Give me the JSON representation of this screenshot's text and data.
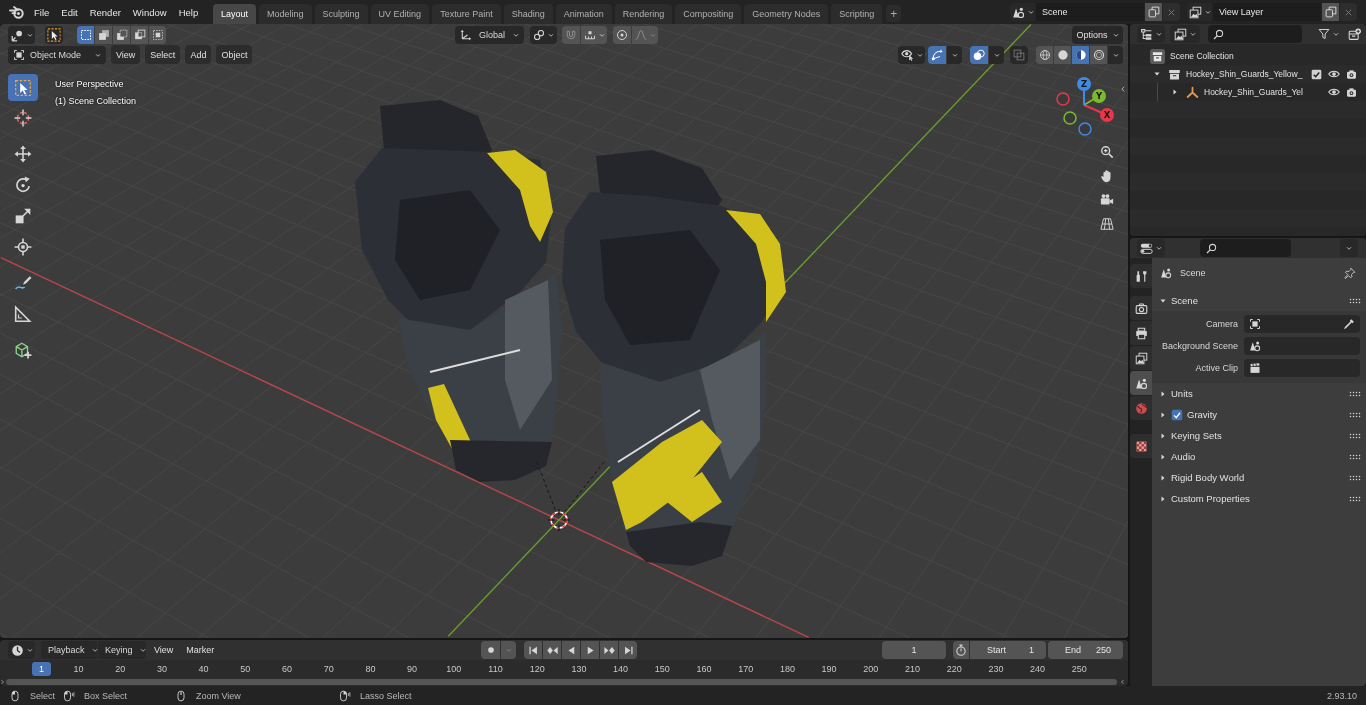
{
  "topbar": {
    "menus": [
      "File",
      "Edit",
      "Render",
      "Window",
      "Help"
    ],
    "workspaces": [
      {
        "label": "Layout",
        "selected": true
      },
      {
        "label": "Modeling",
        "selected": false
      },
      {
        "label": "Sculpting",
        "selected": false
      },
      {
        "label": "UV Editing",
        "selected": false
      },
      {
        "label": "Texture Paint",
        "selected": false
      },
      {
        "label": "Shading",
        "selected": false
      },
      {
        "label": "Animation",
        "selected": false
      },
      {
        "label": "Rendering",
        "selected": false
      },
      {
        "label": "Compositing",
        "selected": false
      },
      {
        "label": "Geometry Nodes",
        "selected": false
      },
      {
        "label": "Scripting",
        "selected": false
      }
    ],
    "add_workspace": "+",
    "scene": "Scene",
    "view_layer": "View Layer"
  },
  "viewport": {
    "tool_header": {
      "select_modes": [
        {
          "kind": "set",
          "selected": true
        },
        {
          "kind": "extend",
          "selected": false
        },
        {
          "kind": "subtract",
          "selected": false
        },
        {
          "kind": "difference",
          "selected": false
        },
        {
          "kind": "intersect",
          "selected": false
        }
      ],
      "orientation": "Global",
      "options": "Options"
    },
    "header": {
      "mode": "Object Mode",
      "menus": [
        "View",
        "Select",
        "Add",
        "Object"
      ],
      "toggles": [
        {
          "kind": "selectability",
          "on": false
        },
        {
          "kind": "gizmo",
          "on": true
        },
        {
          "kind": "overlay",
          "on": true
        },
        {
          "kind": "xray",
          "on": false
        }
      ],
      "shading": [
        {
          "kind": "wireframe",
          "selected": false
        },
        {
          "kind": "solid",
          "selected": false
        },
        {
          "kind": "material",
          "selected": true
        },
        {
          "kind": "rendered",
          "selected": false
        }
      ]
    },
    "view_name": "User Perspective",
    "collection_label": "(1) Scene Collection",
    "tool_groups": [
      [
        {
          "kind": "select_box",
          "selected": true
        }
      ],
      [
        {
          "kind": "cursor",
          "selected": false
        }
      ],
      [
        {
          "kind": "move",
          "selected": false
        },
        {
          "kind": "rotate",
          "selected": false
        },
        {
          "kind": "scale",
          "selected": false
        },
        {
          "kind": "transform",
          "selected": false
        }
      ],
      [
        {
          "kind": "annotate",
          "selected": false
        },
        {
          "kind": "measure",
          "selected": false
        }
      ],
      [
        {
          "kind": "add_cube",
          "selected": false
        }
      ]
    ],
    "nav_axes": [
      {
        "label": "X",
        "color": "#e8374b"
      },
      {
        "label": "Y",
        "color": "#7bb92e"
      },
      {
        "label": "Z",
        "color": "#3f8ae5"
      }
    ]
  },
  "outliner": {
    "tree": [
      {
        "label": "Scene Collection",
        "kind": "scene_collection",
        "children": [
          {
            "label": "Hockey_Shin_Guards_Yellow_",
            "kind": "collection",
            "expanded": true,
            "checked": true,
            "visible": true,
            "renderable": true,
            "children": [
              {
                "label": "Hockey_Shin_Guards_Yel",
                "kind": "empty",
                "expanded": false,
                "visible": true,
                "renderable": true
              }
            ]
          }
        ]
      }
    ]
  },
  "properties": {
    "tab_groups": [
      [
        {
          "kind": "tool",
          "selected": false
        }
      ],
      [
        {
          "kind": "render",
          "selected": false
        },
        {
          "kind": "output",
          "selected": false
        },
        {
          "kind": "view_layer",
          "selected": false
        },
        {
          "kind": "scene",
          "selected": true
        },
        {
          "kind": "world",
          "selected": false
        }
      ],
      [
        {
          "kind": "texture",
          "selected": false
        }
      ]
    ],
    "context": "Scene",
    "panels": [
      {
        "title": "Scene",
        "expanded": true,
        "fields": [
          {
            "label": "Camera",
            "kind": "object"
          },
          {
            "label": "Background Scene",
            "kind": "scene"
          },
          {
            "label": "Active Clip",
            "kind": "clip"
          }
        ]
      },
      {
        "title": "Units",
        "expanded": false
      },
      {
        "title": "Gravity",
        "expanded": false,
        "checked": true
      },
      {
        "title": "Keying Sets",
        "expanded": false
      },
      {
        "title": "Audio",
        "expanded": false
      },
      {
        "title": "Rigid Body World",
        "expanded": false
      },
      {
        "title": "Custom Properties",
        "expanded": false
      }
    ]
  },
  "timeline": {
    "menus": [
      {
        "label": "Playback",
        "kind": "dropdown"
      },
      {
        "label": "Keying",
        "kind": "dropdown"
      },
      {
        "label": "View",
        "kind": "menu"
      },
      {
        "label": "Marker",
        "kind": "menu"
      }
    ],
    "auto_keying": {
      "on": false
    },
    "current_frame": "1",
    "start": {
      "label": "Start",
      "value": "1"
    },
    "end": {
      "label": "End",
      "value": "250"
    },
    "playhead": "1",
    "ruler": [
      "10",
      "20",
      "30",
      "40",
      "50",
      "60",
      "70",
      "80",
      "90",
      "100",
      "110",
      "120",
      "130",
      "140",
      "150",
      "160",
      "170",
      "180",
      "190",
      "200",
      "210",
      "220",
      "230",
      "240",
      "250"
    ]
  },
  "status_bar": {
    "hints": [
      {
        "kind": "left_click",
        "label": "Select"
      },
      {
        "kind": "left_drag",
        "label": "Box Select"
      },
      {
        "kind": "middle",
        "label": "Zoom View"
      },
      {
        "kind": "right_drag",
        "label": "Lasso Select"
      }
    ],
    "version": "2.93.10"
  }
}
